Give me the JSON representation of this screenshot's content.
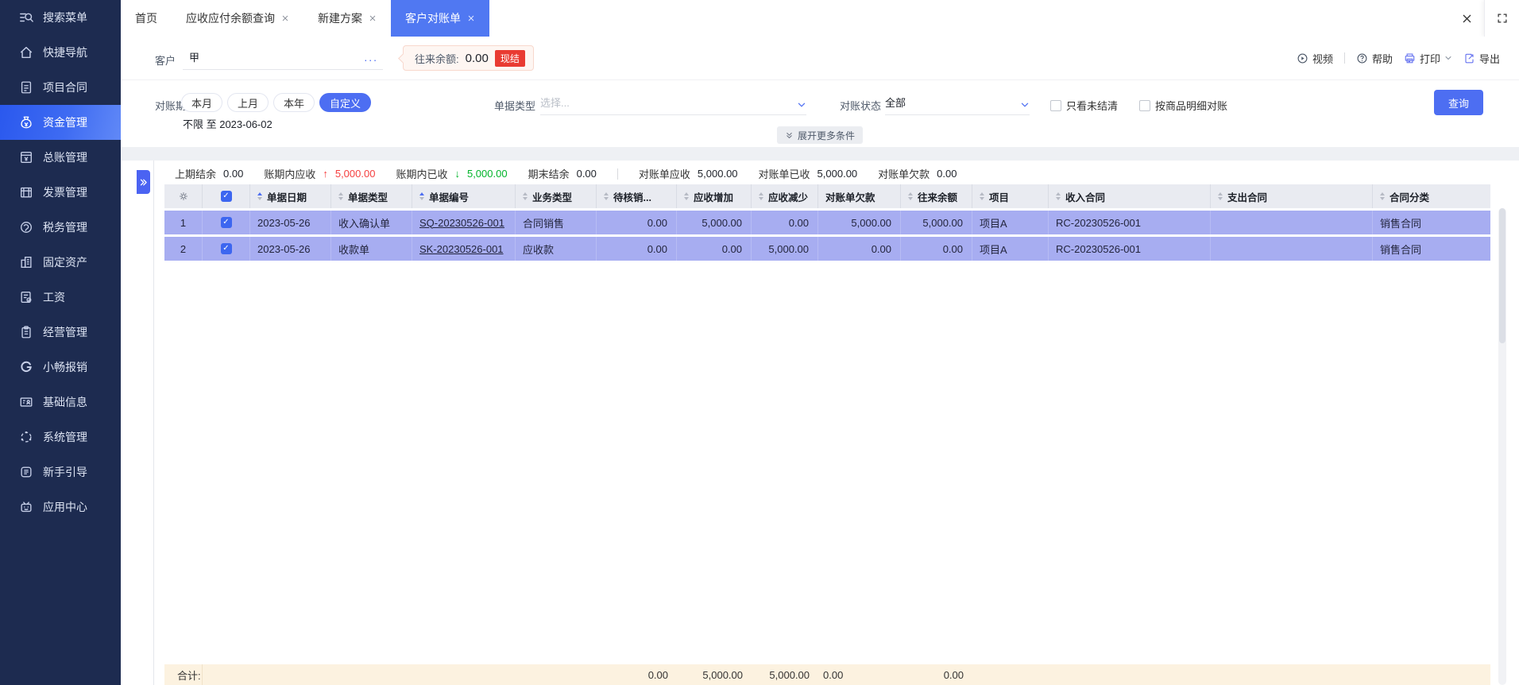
{
  "colors": {
    "sidebar_bg": "#1d2b50",
    "accent_blue": "#4d6ef2",
    "active_tab": "#5078f2",
    "row_highlight": "#a7adf1",
    "footer_bg": "#fcf2e0",
    "badge_red": "#e93b32",
    "value_red": "#f53f3f",
    "value_green": "#00b42a"
  },
  "sidebar": {
    "items": [
      {
        "label": "搜索菜单",
        "icon": "search-icon"
      },
      {
        "label": "快捷导航",
        "icon": "home-icon"
      },
      {
        "label": "项目合同",
        "icon": "contract-icon"
      },
      {
        "label": "资金管理",
        "icon": "money-icon",
        "active": true
      },
      {
        "label": "总账管理",
        "icon": "ledger-icon"
      },
      {
        "label": "发票管理",
        "icon": "invoice-icon"
      },
      {
        "label": "税务管理",
        "icon": "tax-icon"
      },
      {
        "label": "固定资产",
        "icon": "fixed-asset-icon"
      },
      {
        "label": "工资",
        "icon": "salary-icon"
      },
      {
        "label": "经营管理",
        "icon": "business-icon"
      },
      {
        "label": "小畅报销",
        "icon": "expense-icon"
      },
      {
        "label": "基础信息",
        "icon": "base-info-icon"
      },
      {
        "label": "系统管理",
        "icon": "system-icon"
      },
      {
        "label": "新手引导",
        "icon": "guide-icon"
      },
      {
        "label": "应用中心",
        "icon": "app-center-icon"
      }
    ]
  },
  "tabs": [
    {
      "label": "首页",
      "closable": false,
      "active": false
    },
    {
      "label": "应收应付余额查询",
      "closable": true,
      "active": false
    },
    {
      "label": "新建方案",
      "closable": true,
      "active": false
    },
    {
      "label": "客户对账单",
      "closable": true,
      "active": true
    }
  ],
  "toolbar": {
    "customer_label": "客户",
    "customer_value": "甲",
    "more_ellipsis": "...",
    "balance_label": "往来余额:",
    "balance_value": "0.00",
    "balance_badge": "现结",
    "video_label": "视频",
    "help_label": "帮助",
    "print_label": "打印",
    "export_label": "导出"
  },
  "filters": {
    "period_label": "对账期间",
    "period_options": [
      {
        "label": "本月",
        "active": false
      },
      {
        "label": "上月",
        "active": false
      },
      {
        "label": "本年",
        "active": false
      },
      {
        "label": "自定义",
        "active": true
      }
    ],
    "period_range": "不限 至 2023-06-02",
    "doc_type_label": "单据类型",
    "doc_type_placeholder": "选择...",
    "status_label": "对账状态",
    "status_value": "全部",
    "checkbox_unsettled": "只看未结清",
    "checkbox_by_product": "按商品明细对账",
    "query_button": "查询",
    "expand_more": "展开更多条件"
  },
  "summary": {
    "items": [
      {
        "label": "上期结余",
        "value": "0.00",
        "trend": "none"
      },
      {
        "label": "账期内应收",
        "value": "5,000.00",
        "trend": "up"
      },
      {
        "label": "账期内已收",
        "value": "5,000.00",
        "trend": "down"
      },
      {
        "label": "期末结余",
        "value": "0.00",
        "trend": "none"
      },
      {
        "label": "对账单应收",
        "value": "5,000.00",
        "trend": "none"
      },
      {
        "label": "对账单已收",
        "value": "5,000.00",
        "trend": "none"
      },
      {
        "label": "对账单欠款",
        "value": "0.00",
        "trend": "none"
      }
    ],
    "up_arrow": "↑",
    "down_arrow": "↓"
  },
  "table": {
    "columns": [
      {
        "label": "单据日期",
        "sort": "asc"
      },
      {
        "label": "单据类型",
        "sort": "none"
      },
      {
        "label": "单据编号",
        "sort": "asc"
      },
      {
        "label": "业务类型",
        "sort": "none"
      },
      {
        "label": "待核销...",
        "sort": "none"
      },
      {
        "label": "应收增加",
        "sort": "none"
      },
      {
        "label": "应收减少",
        "sort": "none"
      },
      {
        "label": "对账单欠款",
        "sort": null
      },
      {
        "label": "往来余额",
        "sort": "none"
      },
      {
        "label": "项目",
        "sort": "none"
      },
      {
        "label": "收入合同",
        "sort": "none"
      },
      {
        "label": "支出合同",
        "sort": "none"
      },
      {
        "label": "合同分类",
        "sort": "none"
      }
    ],
    "rows": [
      {
        "index": "1",
        "checked": true,
        "date": "2023-05-26",
        "type": "收入确认单",
        "number": "SQ-20230526-001",
        "business": "合同销售",
        "pending": "0.00",
        "increase": "5,000.00",
        "decrease": "0.00",
        "owed": "5,000.00",
        "balance": "5,000.00",
        "project": "项目A",
        "income_contract": "RC-20230526-001",
        "expense_contract": "",
        "category": "销售合同"
      },
      {
        "index": "2",
        "checked": true,
        "date": "2023-05-26",
        "type": "收款单",
        "number": "SK-20230526-001",
        "business": "应收款",
        "pending": "0.00",
        "increase": "0.00",
        "decrease": "5,000.00",
        "owed": "0.00",
        "balance": "0.00",
        "project": "项目A",
        "income_contract": "RC-20230526-001",
        "expense_contract": "",
        "category": "销售合同"
      }
    ],
    "footer": {
      "label": "合计:",
      "pending": "0.00",
      "increase": "5,000.00",
      "decrease": "5,000.00",
      "owed": "0.00",
      "balance": "0.00"
    }
  }
}
